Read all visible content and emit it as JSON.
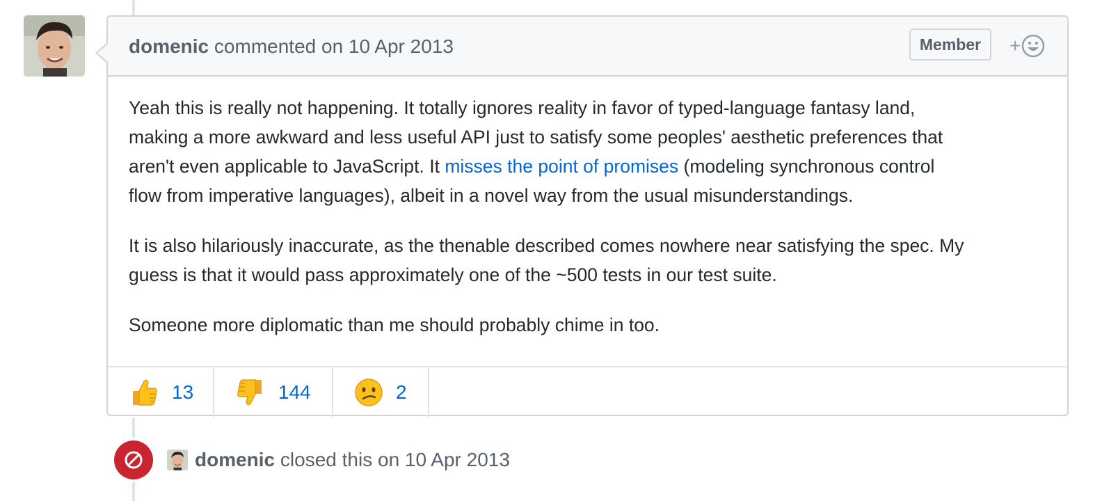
{
  "comment": {
    "author": "domenic",
    "action": "commented on",
    "date": "10 Apr 2013",
    "badge": "Member",
    "add_reaction": "+",
    "body": [
      {
        "before": "Yeah this is really not happening. It totally ignores reality in favor of typed-language fantasy land,",
        "line2": "making a more awkward and less useful API just to satisfy some peoples' aesthetic preferences that",
        "line3_pre": "aren't even applicable to JavaScript. It ",
        "link": "misses the point of promises",
        "line3_post": " (modeling synchronous control",
        "line4": "flow from imperative languages), albeit in a novel way from the usual misunderstandings."
      },
      {
        "line1": "It is also hilariously inaccurate, as the thenable described comes nowhere near satisfying the spec. My",
        "line2": "guess is that it would pass approximately one of the ~500 tests in our test suite."
      },
      {
        "line1": "Someone more diplomatic than me should probably chime in too."
      }
    ],
    "reactions": [
      {
        "icon": "thumbs-up-icon",
        "count": "13"
      },
      {
        "icon": "thumbs-down-icon",
        "count": "144"
      },
      {
        "icon": "confused-face-icon",
        "count": "2"
      }
    ]
  },
  "event": {
    "author": "domenic",
    "action": "closed this on",
    "date": "10 Apr 2013",
    "icon": "circle-slash-icon"
  },
  "colors": {
    "link": "#0366d6",
    "closed": "#cb2431",
    "header_bg": "#f6f8fa",
    "border": "#d1d5da"
  }
}
